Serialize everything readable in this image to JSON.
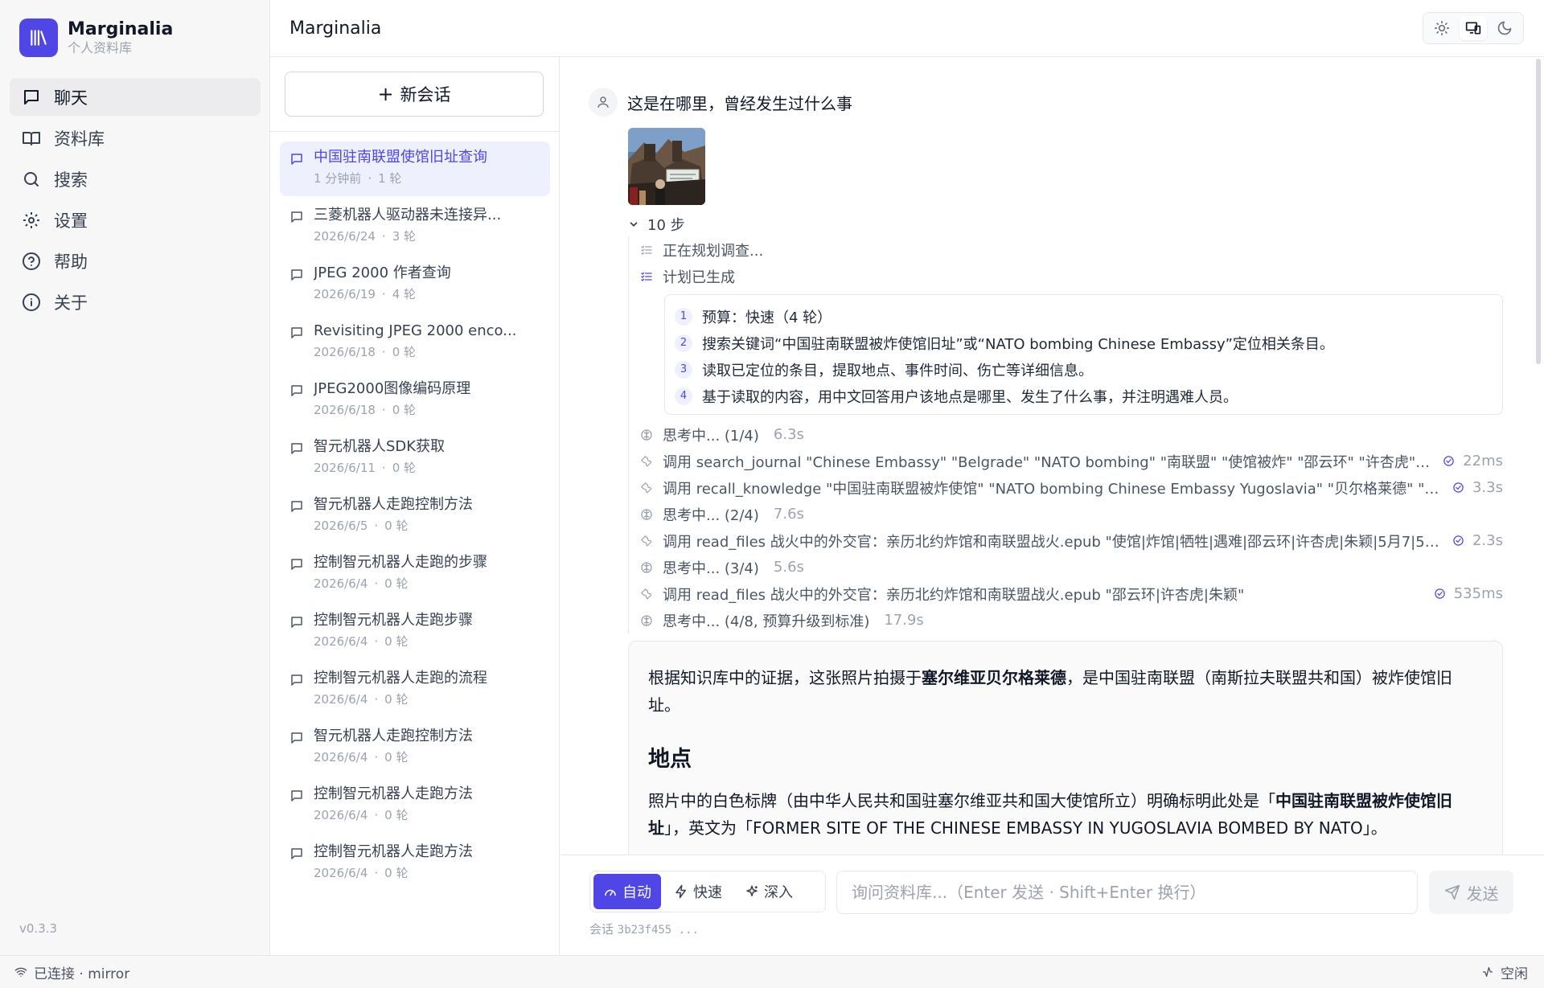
{
  "app": {
    "name": "Marginalia",
    "subtitle": "个人资料库",
    "version": "v0.3.3",
    "accent": "#4f46e5"
  },
  "sidebar": {
    "items": [
      {
        "label": "聊天",
        "icon": "chat-icon",
        "active": true
      },
      {
        "label": "资料库",
        "icon": "book-icon"
      },
      {
        "label": "搜索",
        "icon": "search-icon"
      },
      {
        "label": "设置",
        "icon": "gear-icon"
      },
      {
        "label": "帮助",
        "icon": "help-icon"
      },
      {
        "label": "关于",
        "icon": "info-icon"
      }
    ]
  },
  "header": {
    "title": "Marginalia",
    "theme_options": [
      "light",
      "system",
      "dark"
    ],
    "theme_selected": "system"
  },
  "conversations": {
    "new_label": "新会话",
    "items": [
      {
        "title": "中国驻南联盟使馆旧址查询",
        "date": "1 分钟前",
        "turns": "1 轮",
        "active": true
      },
      {
        "title": "三菱机器人驱动器未连接异...",
        "date": "2026/6/24",
        "turns": "3 轮"
      },
      {
        "title": "JPEG 2000 作者查询",
        "date": "2026/6/19",
        "turns": "4 轮"
      },
      {
        "title": "Revisiting JPEG 2000 enco...",
        "date": "2026/6/18",
        "turns": "0 轮"
      },
      {
        "title": "JPEG2000图像编码原理",
        "date": "2026/6/18",
        "turns": "0 轮"
      },
      {
        "title": "智元机器人SDK获取",
        "date": "2026/6/11",
        "turns": "0 轮"
      },
      {
        "title": "智元机器人走跑控制方法",
        "date": "2026/6/5",
        "turns": "0 轮"
      },
      {
        "title": "控制智元机器人走跑的步骤",
        "date": "2026/6/4",
        "turns": "0 轮"
      },
      {
        "title": "控制智元机器人走跑步骤",
        "date": "2026/6/4",
        "turns": "0 轮"
      },
      {
        "title": "控制智元机器人走跑的流程",
        "date": "2026/6/4",
        "turns": "0 轮"
      },
      {
        "title": "智元机器人走跑控制方法",
        "date": "2026/6/4",
        "turns": "0 轮"
      },
      {
        "title": "控制智元机器人走跑方法",
        "date": "2026/6/4",
        "turns": "0 轮"
      },
      {
        "title": "控制智元机器人走跑方法",
        "date": "2026/6/4",
        "turns": "0 轮"
      }
    ]
  },
  "chat": {
    "user_message": "这是在哪里，曾经发生过什么事",
    "steps_label": "10 步",
    "planning": "正在规划调查...",
    "plan_done": "计划已生成",
    "plan": [
      "预算：快速（4 轮）",
      "搜索关键词“中国驻南联盟被炸使馆旧址”或“NATO bombing Chinese Embassy”定位相关条目。",
      "读取已定位的条目，提取地点、事件时间、伤亡等详细信息。",
      "基于读取的内容，用中文回答用户该地点是哪里、发生了什么事，并注明遇难人员。"
    ],
    "steps": [
      {
        "type": "think",
        "text": "思考中... (1/4)",
        "time": "6.3s"
      },
      {
        "type": "tool",
        "text": "调用 search_journal \"Chinese Embassy\" \"Belgrade\" \"NATO bombing\" \"南联盟\" \"使馆被炸\" \"邵云环\" \"许杏虎\" \"朱...",
        "time": "22ms"
      },
      {
        "type": "tool",
        "text": "调用 recall_knowledge \"中国驻南联盟被炸使馆\" \"NATO bombing Chinese Embassy Yugoslavia\" \"贝尔格莱德\" \"邵云...",
        "time": "3.3s"
      },
      {
        "type": "think",
        "text": "思考中... (2/4)",
        "time": "7.6s"
      },
      {
        "type": "tool",
        "text": "调用 read_files 战火中的外交官：亲历北约炸馆和南联盟战火.epub \"使馆|炸馆|牺牲|遇难|邵云环|许杏虎|朱颖|5月7|5月...",
        "time": "2.3s"
      },
      {
        "type": "think",
        "text": "思考中... (3/4)",
        "time": "5.6s"
      },
      {
        "type": "tool",
        "text": "调用 read_files 战火中的外交官：亲历北约炸馆和南联盟战火.epub \"邵云环|许杏虎|朱颖\"",
        "time": "535ms"
      },
      {
        "type": "think",
        "text": "思考中... (4/8, 预算升级到标准)",
        "time": "17.9s"
      }
    ],
    "answer": {
      "p1_pre": "根据知识库中的证据，这张照片拍摄于",
      "p1_bold": "塞尔维亚贝尔格莱德",
      "p1_post": "，是中国驻南联盟（南斯拉夫联盟共和国）被炸使馆旧址。",
      "h_location": "地点",
      "p2_pre": "照片中的白色标牌（由中华人民共和国驻塞尔维亚共和国大使馆所立）明确标明此处是「",
      "p2_bold": "中国驻南联盟被炸使馆旧址",
      "p2_post": "」，英文为「FORMER SITE OF THE CHINESE EMBASSY IN YUGOSLAVIA BOMBED BY NATO」。"
    }
  },
  "composer": {
    "modes": [
      {
        "label": "自动",
        "icon": "gauge-icon",
        "active": true
      },
      {
        "label": "快速",
        "icon": "bolt-icon"
      },
      {
        "label": "深入",
        "icon": "sparkle-icon"
      }
    ],
    "placeholder": "询问资料库...（Enter 发送 · Shift+Enter 换行）",
    "value": "",
    "send_label": "发送",
    "session_label": "会话",
    "session_id": "3b23f455 ..."
  },
  "status": {
    "connection": "已连接 · mirror",
    "activity": "空闲"
  }
}
